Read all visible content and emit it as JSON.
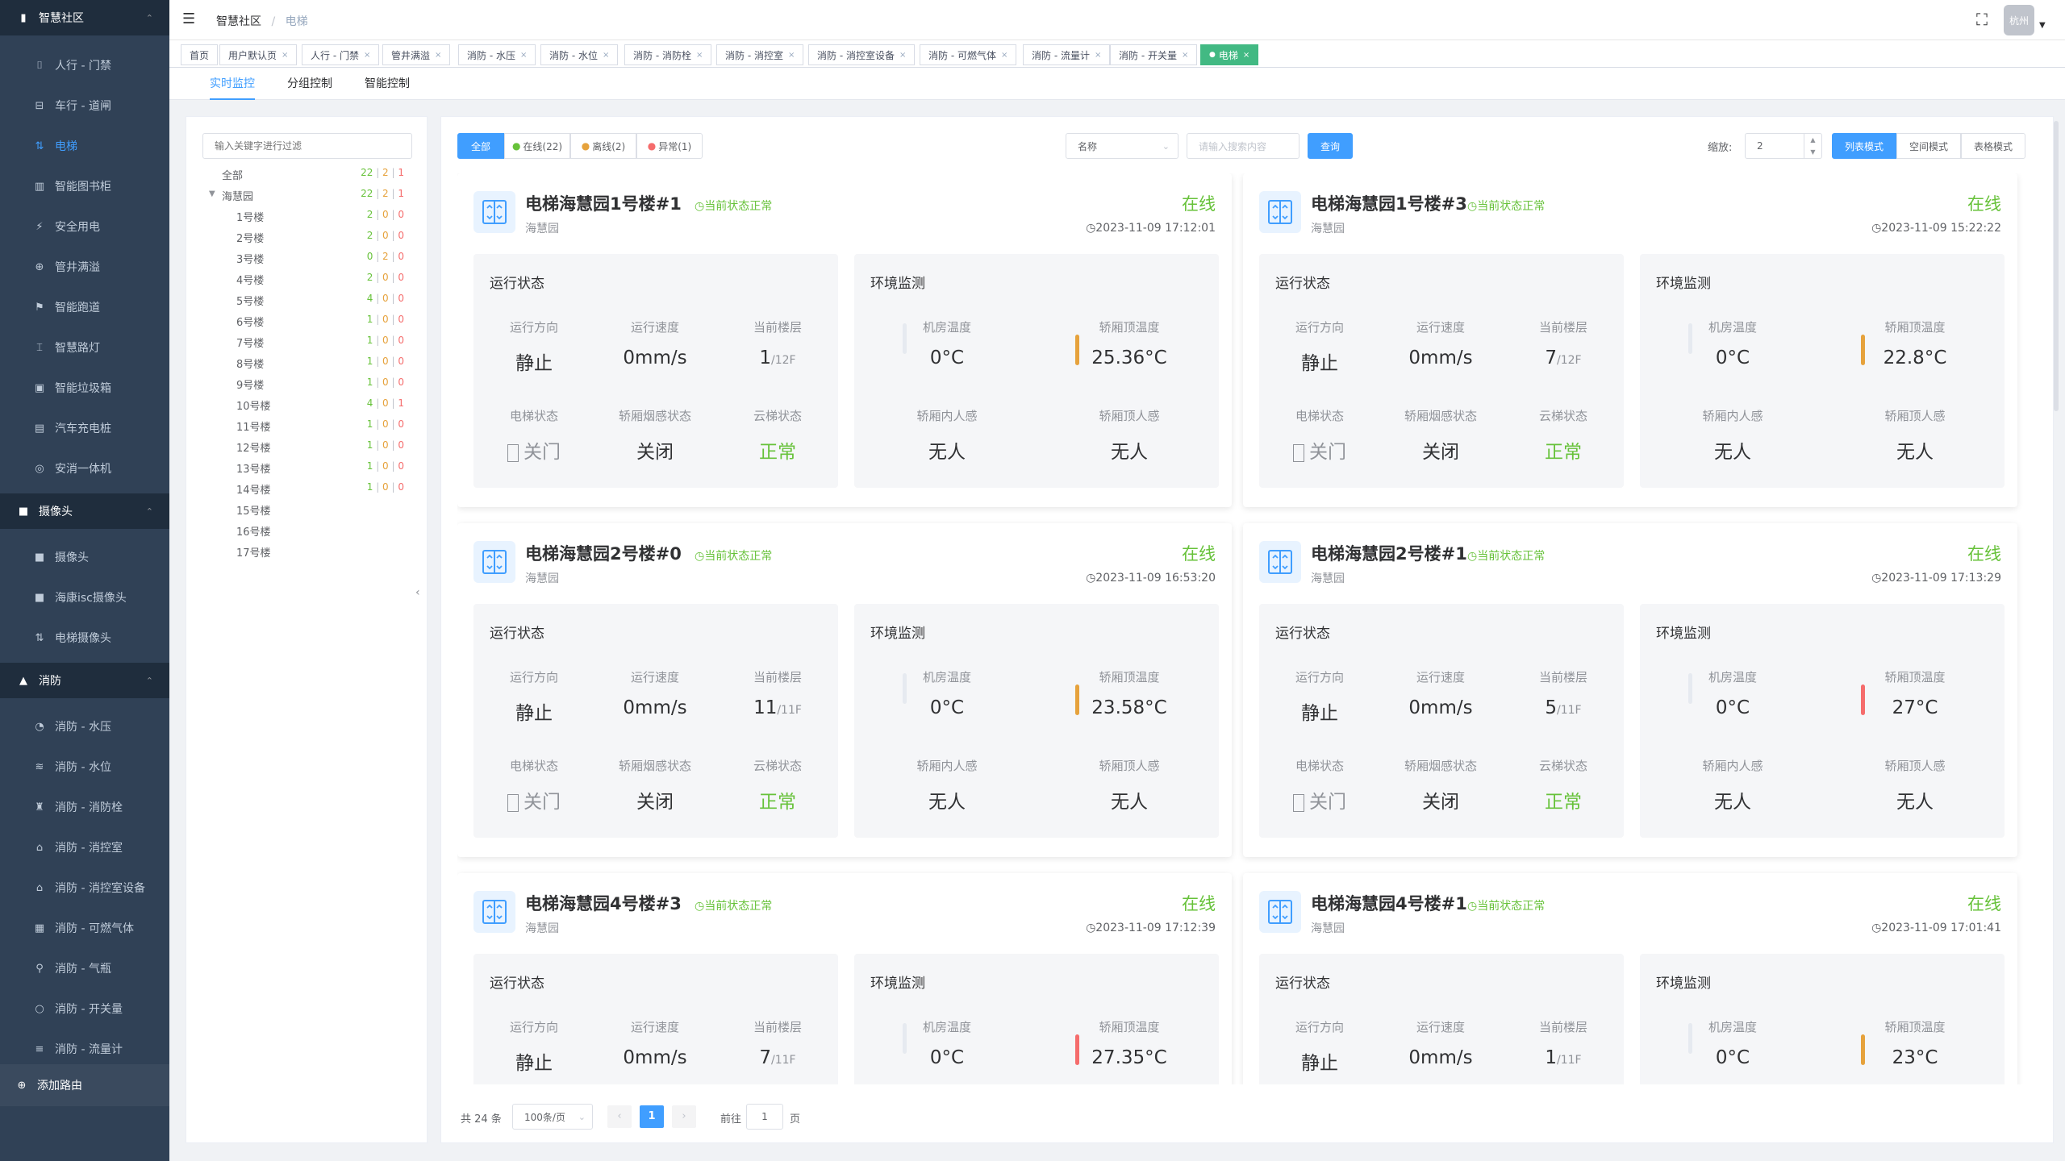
{
  "sidebar": {
    "groups": [
      {
        "label": "智慧社区",
        "icon": "chart-icon",
        "top": 0,
        "items": [
          {
            "label": "人行 - 门禁",
            "icon": "gate-icon"
          },
          {
            "label": "车行 - 道闸",
            "icon": "car-icon"
          },
          {
            "label": "电梯",
            "icon": "elevator-icon",
            "active": true
          },
          {
            "label": "智能图书柜",
            "icon": "book-icon"
          },
          {
            "label": "安全用电",
            "icon": "power-icon"
          },
          {
            "label": "管井满溢",
            "icon": "pipe-icon"
          },
          {
            "label": "智能跑道",
            "icon": "run-icon"
          },
          {
            "label": "智慧路灯",
            "icon": "lamp-icon"
          },
          {
            "label": "智能垃圾箱",
            "icon": "trash-icon"
          },
          {
            "label": "汽车充电桩",
            "icon": "charger-icon"
          },
          {
            "label": "安消一体机",
            "icon": "fire-device-icon"
          }
        ]
      },
      {
        "label": "摄像头",
        "icon": "camera-icon",
        "items": [
          {
            "label": "摄像头",
            "icon": "camera-icon"
          },
          {
            "label": "海康isc摄像头",
            "icon": "camera-icon"
          },
          {
            "label": "电梯摄像头",
            "icon": "elevator-icon"
          }
        ]
      },
      {
        "label": "消防",
        "icon": "fire-icon",
        "items": [
          {
            "label": "消防 - 水压",
            "icon": "gauge-icon"
          },
          {
            "label": "消防 - 水位",
            "icon": "water-icon"
          },
          {
            "label": "消防 - 消防栓",
            "icon": "hydrant-icon"
          },
          {
            "label": "消防 - 消控室",
            "icon": "room-icon"
          },
          {
            "label": "消防 - 消控室设备",
            "icon": "room-icon"
          },
          {
            "label": "消防 - 可燃气体",
            "icon": "gas-icon"
          },
          {
            "label": "消防 - 气瓶",
            "icon": "cylinder-icon"
          },
          {
            "label": "消防 - 开关量",
            "icon": "switch-icon"
          },
          {
            "label": "消防 - 流量计",
            "icon": "flow-icon"
          }
        ]
      }
    ],
    "add_route": "添加路由"
  },
  "header": {
    "breadcrumb_root": "智慧社区",
    "breadcrumb_sep": "/",
    "breadcrumb_current": "电梯",
    "user_name": "杭州"
  },
  "tags": [
    "首页",
    "用户默认页",
    "人行 - 门禁",
    "管井满溢",
    "消防 - 水压",
    "消防 - 水位",
    "消防 - 消防栓",
    "消防 - 消控室",
    "消防 - 消控室设备",
    "消防 - 可燃气体",
    "消防 - 流量计",
    "消防 - 开关量",
    "电梯"
  ],
  "subtabs": [
    "实时监控",
    "分组控制",
    "智能控制"
  ],
  "tree": {
    "placeholder": "输入关键字进行过滤",
    "rows": [
      {
        "name": "全部",
        "level": 0,
        "on": "22",
        "off": "2",
        "err": "1"
      },
      {
        "name": "海慧园",
        "level": 1,
        "expand": true,
        "on": "22",
        "off": "2",
        "err": "1"
      },
      {
        "name": "1号楼",
        "level": 2,
        "on": "2",
        "off": "0",
        "err": "0"
      },
      {
        "name": "2号楼",
        "level": 2,
        "on": "2",
        "off": "0",
        "err": "0"
      },
      {
        "name": "3号楼",
        "level": 2,
        "on": "0",
        "off": "2",
        "err": "0"
      },
      {
        "name": "4号楼",
        "level": 2,
        "on": "2",
        "off": "0",
        "err": "0"
      },
      {
        "name": "5号楼",
        "level": 2,
        "on": "4",
        "off": "0",
        "err": "0"
      },
      {
        "name": "6号楼",
        "level": 2,
        "on": "1",
        "off": "0",
        "err": "0"
      },
      {
        "name": "7号楼",
        "level": 2,
        "on": "1",
        "off": "0",
        "err": "0"
      },
      {
        "name": "8号楼",
        "level": 2,
        "on": "1",
        "off": "0",
        "err": "0"
      },
      {
        "name": "9号楼",
        "level": 2,
        "on": "1",
        "off": "0",
        "err": "0"
      },
      {
        "name": "10号楼",
        "level": 2,
        "on": "4",
        "off": "0",
        "err": "1"
      },
      {
        "name": "11号楼",
        "level": 2,
        "on": "1",
        "off": "0",
        "err": "0"
      },
      {
        "name": "12号楼",
        "level": 2,
        "on": "1",
        "off": "0",
        "err": "0"
      },
      {
        "name": "13号楼",
        "level": 2,
        "on": "1",
        "off": "0",
        "err": "0"
      },
      {
        "name": "14号楼",
        "level": 2,
        "on": "1",
        "off": "0",
        "err": "0"
      },
      {
        "name": "15号楼",
        "level": 2
      },
      {
        "name": "16号楼",
        "level": 2
      },
      {
        "name": "17号楼",
        "level": 2
      }
    ]
  },
  "filter": {
    "all": "全部",
    "online": "在线(22)",
    "offline": "离线(2)",
    "error": "异常(1)",
    "select_value": "名称",
    "search_placeholder": "请输入搜索内容",
    "query": "查询",
    "zoom_label": "缩放:",
    "zoom_value": "2",
    "mode_list": "列表模式",
    "mode_space": "空间模式",
    "mode_table": "表格模式"
  },
  "labels": {
    "run_status": "运行状态",
    "env_monitor": "环境监测",
    "direction": "运行方向",
    "speed": "运行速度",
    "floor": "当前楼层",
    "elevator_status": "电梯状态",
    "smoke": "轿厢烟感状态",
    "cloud": "云梯状态",
    "machine_temp": "机房温度",
    "top_temp": "轿厢顶温度",
    "cabin_person": "轿厢内人感",
    "top_person": "轿厢顶人感",
    "state_normal": "◷当前状态正常"
  },
  "cards": [
    {
      "title": "电梯海慧园1号楼#1",
      "sub": "海慧园",
      "online": "在线",
      "time": "◷2023-11-09 17:12:01",
      "direction": "静止",
      "speed": "0mm/s",
      "floor": "1",
      "floor_total": "/12F",
      "door": "关门",
      "smoke": "关闭",
      "cloud": "正常",
      "machine_temp": "0°C",
      "top_temp": "25.36°C",
      "top_level": "orange",
      "cabin_person": "无人",
      "top_person": "无人"
    },
    {
      "title": "电梯海慧园1号楼#3",
      "sub": "海慧园",
      "online": "在线",
      "time": "◷2023-11-09 15:22:22",
      "direction": "静止",
      "speed": "0mm/s",
      "floor": "7",
      "floor_total": "/12F",
      "door": "关门",
      "smoke": "关闭",
      "cloud": "正常",
      "machine_temp": "0°C",
      "top_temp": "22.8°C",
      "top_level": "orange",
      "cabin_person": "无人",
      "top_person": "无人"
    },
    {
      "title": "电梯海慧园2号楼#0",
      "sub": "海慧园",
      "online": "在线",
      "time": "◷2023-11-09 16:53:20",
      "direction": "静止",
      "speed": "0mm/s",
      "floor": "11",
      "floor_total": "/11F",
      "door": "关门",
      "smoke": "关闭",
      "cloud": "正常",
      "machine_temp": "0°C",
      "top_temp": "23.58°C",
      "top_level": "orange",
      "cabin_person": "无人",
      "top_person": "无人"
    },
    {
      "title": "电梯海慧园2号楼#1",
      "sub": "海慧园",
      "online": "在线",
      "time": "◷2023-11-09 17:13:29",
      "direction": "静止",
      "speed": "0mm/s",
      "floor": "5",
      "floor_total": "/11F",
      "door": "关门",
      "smoke": "关闭",
      "cloud": "正常",
      "machine_temp": "0°C",
      "top_temp": "27°C",
      "top_level": "red",
      "cabin_person": "无人",
      "top_person": "无人"
    },
    {
      "title": "电梯海慧园4号楼#3",
      "sub": "海慧园",
      "online": "在线",
      "time": "◷2023-11-09 17:12:39",
      "direction": "静止",
      "speed": "0mm/s",
      "floor": "7",
      "floor_total": "/11F",
      "machine_temp": "0°C",
      "top_temp": "27.35°C",
      "top_level": "red"
    },
    {
      "title": "电梯海慧园4号楼#1",
      "sub": "海慧园",
      "online": "在线",
      "time": "◷2023-11-09 17:01:41",
      "direction": "静止",
      "speed": "0mm/s",
      "floor": "1",
      "floor_total": "/11F",
      "machine_temp": "0°C",
      "top_temp": "23°C",
      "top_level": "orange"
    }
  ],
  "pager": {
    "total": "共 24 条",
    "page_size": "100条/页",
    "current": "1",
    "goto_label": "前往",
    "goto_value": "1",
    "page_unit": "页"
  },
  "colors": {
    "primary": "#409eff",
    "success": "#67c23a",
    "warning": "#e6a23c",
    "danger": "#f56c6c",
    "sidebar": "#304156",
    "tag_active": "#42b983"
  }
}
